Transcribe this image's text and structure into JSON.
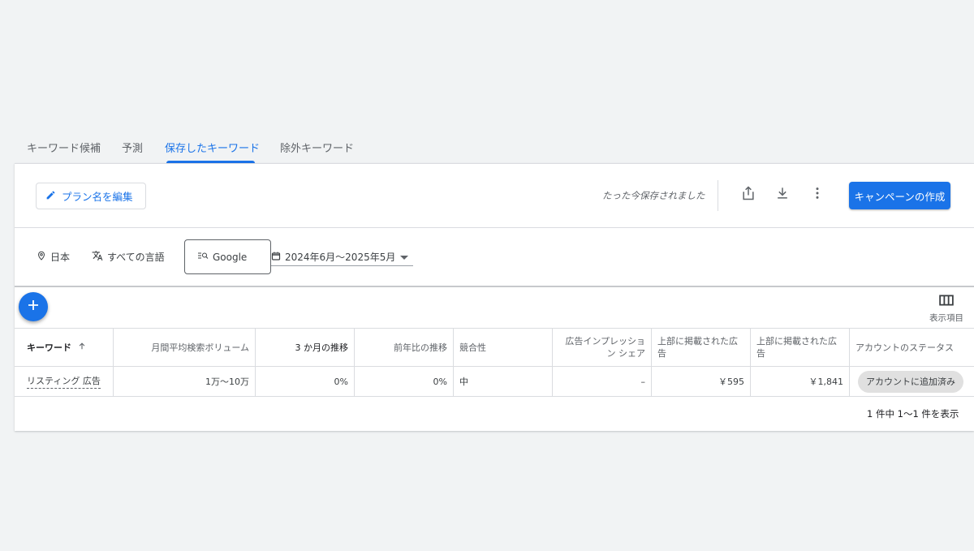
{
  "tabs": [
    {
      "label": "キーワード候補",
      "active": false
    },
    {
      "label": "予測",
      "active": false
    },
    {
      "label": "保存したキーワード",
      "active": true
    },
    {
      "label": "除外キーワード",
      "active": false
    }
  ],
  "header": {
    "edit_plan_label": "プラン名を編集",
    "saved_status": "たった今保存されました",
    "create_campaign_label": "キャンペーンの作成",
    "icons": [
      "share-icon",
      "download-icon",
      "more-vert-icon"
    ]
  },
  "filters": {
    "location": "日本",
    "language": "すべての言語",
    "network": "Google",
    "date_range": "2024年6月～2025年5月"
  },
  "columns_button_label": "表示項目",
  "table": {
    "columns": [
      "キーワード",
      "月間平均検索ボリューム",
      "3 か月の推移",
      "前年比の推移",
      "競合性",
      "広告インプレッション シェア",
      "上部に掲載された広告",
      "上部に掲載された広告",
      "アカウントのステータス"
    ],
    "rows": [
      {
        "keyword": "リスティング 広告",
        "avg_monthly_searches": "1万～10万",
        "three_month_change": "0%",
        "yoy_change": "0%",
        "competition": "中",
        "ad_impression_share": "–",
        "top_of_page_bid_low": "￥595",
        "top_of_page_bid_high": "￥1,841",
        "account_status": "アカウントに追加済み"
      }
    ]
  },
  "pagination": "1 件中 1～1 件を表示",
  "colors": {
    "accent": "#1a73e8",
    "background": "#f1f3f4",
    "chip": "#e0e0e0"
  }
}
